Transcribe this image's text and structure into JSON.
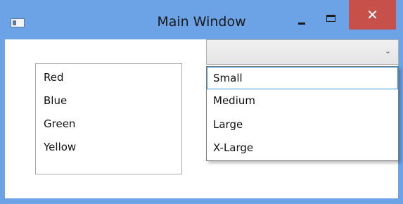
{
  "window": {
    "title": "Main Window",
    "close_glyph": "✕",
    "colors": {
      "frame": "#6ba3e6",
      "close_button": "#c7504b",
      "selection_border": "#3399e0"
    }
  },
  "listbox": {
    "items": [
      "Red",
      "Blue",
      "Green",
      "Yellow"
    ]
  },
  "combobox": {
    "selected_value": "",
    "arrow_glyph": "⌄",
    "options": [
      "Small",
      "Medium",
      "Large",
      "X-Large"
    ],
    "highlighted_option": "Small"
  }
}
